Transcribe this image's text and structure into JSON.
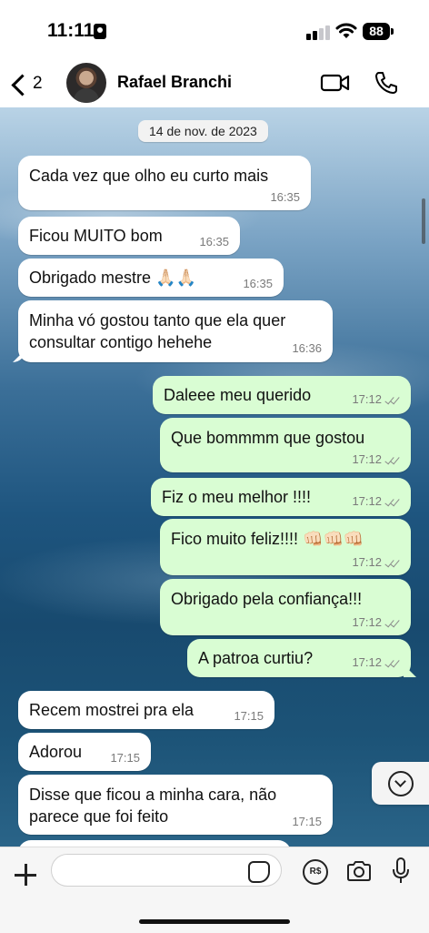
{
  "status_bar": {
    "time": "11:11",
    "battery": "88"
  },
  "header": {
    "back_count": "2",
    "contact_name": "Rafael Branchi"
  },
  "chat": {
    "date_chip": "14 de nov. de 2023",
    "messages": [
      {
        "dir": "in",
        "text": "Cada vez que olho eu curto mais",
        "time": "16:35"
      },
      {
        "dir": "in",
        "text": "Ficou MUITO bom",
        "time": "16:35"
      },
      {
        "dir": "in",
        "text": "Obrigado mestre 🙏🏻🙏🏻",
        "time": "16:35"
      },
      {
        "dir": "in",
        "text": "Minha vó gostou tanto que ela quer\nconsultar contigo hehehe",
        "time": "16:36"
      },
      {
        "dir": "out",
        "text": "Daleee meu querido",
        "time": "17:12"
      },
      {
        "dir": "out",
        "text": "Que bommmm que gostou",
        "time": "17:12"
      },
      {
        "dir": "out",
        "text": "Fiz o meu melhor !!!!",
        "time": "17:12"
      },
      {
        "dir": "out",
        "text": "Fico muito feliz!!!! 👊🏻👊🏻👊🏻",
        "time": "17:12"
      },
      {
        "dir": "out",
        "text": "Obrigado pela confiança!!!",
        "time": "17:12"
      },
      {
        "dir": "out",
        "text": "A patroa curtiu?",
        "time": "17:12"
      },
      {
        "dir": "in",
        "text": "Recem mostrei pra ela",
        "time": "17:15"
      },
      {
        "dir": "in",
        "text": "Adorou",
        "time": "17:15"
      },
      {
        "dir": "in",
        "text": "Disse que ficou a minha cara, não\nparece que foi feito",
        "time": "17:15"
      }
    ]
  },
  "composer": {
    "input_value": "",
    "input_placeholder": ""
  },
  "colors": {
    "incoming": "#ffffff",
    "outgoing": "#d9fdd3"
  },
  "icons": [
    "back-chevron-icon",
    "video-call-icon",
    "phone-icon",
    "scroll-down-icon",
    "plus-icon",
    "sticker-icon",
    "pix-payment-icon",
    "camera-icon",
    "microphone-icon"
  ]
}
